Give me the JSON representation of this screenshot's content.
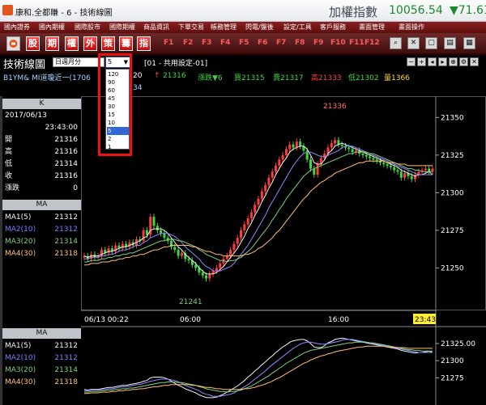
{
  "window": {
    "title": "康和.全都賺 - 6 - 技術線圖",
    "index_name": "加權指數",
    "index_value": "10056.54",
    "index_change": "▼71.61"
  },
  "menu": [
    "國內證券",
    "國內期權",
    "國際股市",
    "國際期權",
    "商品資訊",
    "下單交易",
    "帳務管理",
    "閃電/盤後",
    "設定/工具",
    "客戶服務",
    "畫面管理",
    "畫面操作"
  ],
  "toolbar": {
    "buttons": [
      "股",
      "期",
      "權",
      "外",
      "策",
      "籌",
      "指"
    ],
    "fkeys": [
      "F1",
      "F2",
      "F3",
      "F4",
      "F5",
      "F6",
      "F7",
      "F8",
      "F9",
      "F10",
      "F11",
      "F12"
    ]
  },
  "panel": {
    "title": "技術線圖",
    "period_type": "日週月分",
    "period_value": "5",
    "layout": "[01 - 共用設定-01]",
    "period_options": [
      "120",
      "90",
      "60",
      "45",
      "30",
      "15",
      "10",
      "5",
      "2",
      "1"
    ],
    "selected_period": "5"
  },
  "quote": {
    "symbol": "B1YM&  MI道瓊近一(1706",
    "change_frag": "20",
    "arrow": "↑",
    "last": "21316",
    "pct_label": "漲跌▼6",
    "buy": "買21315",
    "sell": "賣21317",
    "high": "高21333",
    "low": "低21302",
    "volume": "量1366",
    "row2_frag": "34"
  },
  "info": {
    "k_header": "K",
    "date": "2017/06/13",
    "time": "23:43:00",
    "rows": [
      {
        "label": "開",
        "value": "21316",
        "color": "#ffffff"
      },
      {
        "label": "高",
        "value": "21316",
        "color": "#ffffff"
      },
      {
        "label": "低",
        "value": "21314",
        "color": "#ffffff"
      },
      {
        "label": "收",
        "value": "21316",
        "color": "#ffffff"
      },
      {
        "label": "漲跌",
        "value": "0",
        "color": "#ffffff"
      }
    ],
    "ma_header": "MA",
    "ma": [
      {
        "label": "MA1(5)",
        "value": "21312",
        "color": "#f2f2f2"
      },
      {
        "label": "MA2(10)",
        "value": "21312",
        "color": "#7d7dff"
      },
      {
        "label": "MA3(20)",
        "value": "21314",
        "color": "#7fd07f"
      },
      {
        "label": "MA4(30)",
        "value": "21318",
        "color": "#ffc070"
      }
    ],
    "ma2_header": "MA",
    "ma2": [
      {
        "label": "MA1(5)",
        "value": "21312",
        "color": "#f2f2f2"
      },
      {
        "label": "MA2(10)",
        "value": "21312",
        "color": "#7d7dff"
      },
      {
        "label": "MA3(20)",
        "value": "21314",
        "color": "#7fd07f"
      },
      {
        "label": "MA4(30)",
        "value": "21318",
        "color": "#ffc070"
      }
    ]
  },
  "chart_data": {
    "type": "line",
    "y_ticks": [
      "21350",
      "21325",
      "21300",
      "21275",
      "21250"
    ],
    "x_ticks": [
      "06/13 00:22",
      "06:00",
      "16:00"
    ],
    "time_marker": "23:43",
    "annotations": {
      "high": "21336",
      "low": "21241"
    },
    "sub_y_ticks": [
      "21325.00",
      "21300",
      "21275"
    ],
    "ylim": [
      21225,
      21362
    ],
    "close": [
      21258,
      21256,
      21259,
      21257,
      21258,
      21262,
      21260,
      21263,
      21261,
      21265,
      21263,
      21266,
      21264,
      21267,
      21265,
      21269,
      21268,
      21275,
      21272,
      21284,
      21278,
      21275,
      21273,
      21270,
      21268,
      21264,
      21262,
      21258,
      21260,
      21256,
      21255,
      21252,
      21250,
      21247,
      21245,
      21243,
      21246,
      21248,
      21250,
      21253,
      21256,
      21258,
      21262,
      21266,
      21270,
      21275,
      21279,
      21283,
      21287,
      21292,
      21296,
      21301,
      21305,
      21310,
      21314,
      21318,
      21322,
      21325,
      21329,
      21332,
      21330,
      21334,
      21331,
      21328,
      21322,
      21316,
      21312,
      21319,
      21323,
      21326,
      21330,
      21333,
      21335,
      21332,
      21331,
      21330,
      21329,
      21327,
      21328,
      21326,
      21325,
      21324,
      21323,
      21322,
      21321,
      21320,
      21319,
      21318,
      21317,
      21315,
      21314,
      21310,
      21313,
      21311,
      21309,
      21312,
      21314,
      21315,
      21316,
      21314,
      21316
    ],
    "ma1": [
      21258,
      21257,
      21258,
      21258,
      21258,
      21259,
      21260,
      21261,
      21261,
      21262,
      21263,
      21264,
      21264,
      21265,
      21266,
      21267,
      21268,
      21270,
      21271,
      21275,
      21276,
      21276,
      21276,
      21275,
      21273,
      21270,
      21267,
      21264,
      21262,
      21259,
      21257,
      21255,
      21253,
      21250,
      21248,
      21246,
      21246,
      21246,
      21247,
      21249,
      21251,
      21254,
      21257,
      21260,
      21263,
      21267,
      21271,
      21276,
      21280,
      21285,
      21289,
      21294,
      21298,
      21303,
      21307,
      21312,
      21316,
      21320,
      21323,
      21327,
      21329,
      21330,
      21331,
      21331,
      21329,
      21325,
      21320,
      21319,
      21319,
      21322,
      21326,
      21328,
      21331,
      21332,
      21333,
      21332,
      21331,
      21330,
      21329,
      21328,
      21327,
      21326,
      21325,
      21324,
      21323,
      21322,
      21321,
      21320,
      21319,
      21318,
      21317,
      21315,
      21314,
      21313,
      21312,
      21311,
      21312,
      21312,
      21313,
      21314,
      21312
    ],
    "ma2": [
      21256,
      21256,
      21257,
      21257,
      21257,
      21258,
      21258,
      21259,
      21259,
      21260,
      21261,
      21262,
      21262,
      21263,
      21264,
      21265,
      21265,
      21267,
      21268,
      21270,
      21271,
      21272,
      21273,
      21273,
      21273,
      21272,
      21271,
      21269,
      21267,
      21264,
      21262,
      21260,
      21258,
      21256,
      21253,
      21251,
      21250,
      21248,
      21248,
      21248,
      21249,
      21250,
      21251,
      21253,
      21256,
      21259,
      21262,
      21265,
      21269,
      21273,
      21277,
      21281,
      21285,
      21290,
      21294,
      21298,
      21302,
      21306,
      21310,
      21314,
      21318,
      21321,
      21324,
      21326,
      21327,
      21327,
      21326,
      21325,
      21324,
      21324,
      21325,
      21326,
      21327,
      21328,
      21330,
      21331,
      21331,
      21331,
      21330,
      21329,
      21328,
      21327,
      21326,
      21325,
      21324,
      21323,
      21322,
      21321,
      21320,
      21319,
      21318,
      21317,
      21316,
      21315,
      21314,
      21313,
      21312,
      21312,
      21312,
      21312,
      21312
    ],
    "ma3": [
      21254,
      21254,
      21255,
      21255,
      21255,
      21256,
      21256,
      21257,
      21257,
      21258,
      21258,
      21259,
      21259,
      21260,
      21260,
      21261,
      21262,
      21263,
      21264,
      21265,
      21266,
      21267,
      21268,
      21268,
      21269,
      21269,
      21269,
      21268,
      21268,
      21267,
      21266,
      21265,
      21264,
      21262,
      21261,
      21259,
      21258,
      21257,
      21256,
      21255,
      21255,
      21254,
      21255,
      21255,
      21256,
      21257,
      21259,
      21261,
      21263,
      21266,
      21269,
      21272,
      21275,
      21278,
      21282,
      21285,
      21289,
      21292,
      21296,
      21299,
      21302,
      21305,
      21308,
      21311,
      21313,
      21315,
      21316,
      21317,
      21318,
      21319,
      21320,
      21321,
      21322,
      21323,
      21324,
      21325,
      21326,
      21326,
      21327,
      21327,
      21327,
      21327,
      21326,
      21326,
      21325,
      21324,
      21323,
      21322,
      21321,
      21320,
      21319,
      21318,
      21317,
      21316,
      21316,
      21315,
      21315,
      21314,
      21314,
      21314,
      21314
    ],
    "ma4": [
      21252,
      21252,
      21253,
      21253,
      21253,
      21254,
      21254,
      21254,
      21255,
      21255,
      21256,
      21256,
      21257,
      21257,
      21258,
      21258,
      21259,
      21259,
      21260,
      21261,
      21262,
      21262,
      21263,
      21264,
      21264,
      21265,
      21265,
      21265,
      21265,
      21265,
      21265,
      21264,
      21264,
      21263,
      21262,
      21261,
      21261,
      21260,
      21259,
      21259,
      21258,
      21258,
      21258,
      21258,
      21258,
      21258,
      21259,
      21259,
      21260,
      21261,
      21263,
      21264,
      21266,
      21268,
      21270,
      21273,
      21275,
      21278,
      21281,
      21284,
      21287,
      21290,
      21293,
      21296,
      21298,
      21301,
      21303,
      21305,
      21307,
      21308,
      21310,
      21311,
      21313,
      21314,
      21315,
      21316,
      21317,
      21318,
      21319,
      21320,
      21320,
      21321,
      21321,
      21321,
      21321,
      21321,
      21321,
      21320,
      21320,
      21320,
      21319,
      21319,
      21319,
      21318,
      21318,
      21318,
      21318,
      21318,
      21318,
      21318,
      21318
    ]
  }
}
